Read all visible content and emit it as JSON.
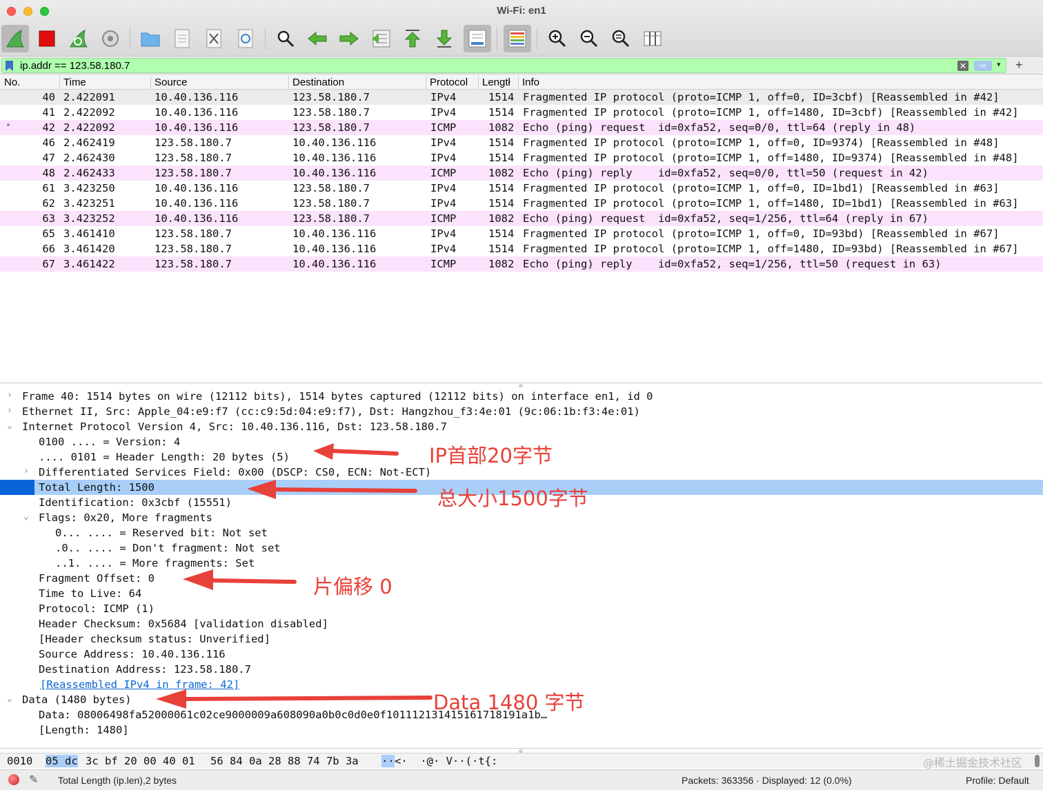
{
  "window": {
    "title": "Wi-Fi: en1"
  },
  "toolbar": {
    "buttons": [
      "start-capture-icon",
      "stop-capture-icon",
      "restart-capture-icon",
      "capture-options-icon",
      "open-file-icon",
      "save-file-icon",
      "close-file-icon",
      "reload-file-icon",
      "find-packet-icon",
      "go-back-icon",
      "go-forward-icon",
      "go-to-packet-icon",
      "go-first-icon",
      "go-last-icon",
      "autoscroll-icon",
      "colorize-icon",
      "zoom-in-icon",
      "zoom-out-icon",
      "zoom-normal-icon",
      "resize-columns-icon"
    ]
  },
  "filter": {
    "value": "ip.addr == 123.58.180.7",
    "clear": "✕",
    "apply": "⇨",
    "dropdown": "▾",
    "add": "+"
  },
  "packet_list": {
    "columns": [
      "No.",
      "Time",
      "Source",
      "Destination",
      "Protocol",
      "Lengtł",
      "Info"
    ],
    "rows": [
      {
        "no": "40",
        "time": "2.422091",
        "src": "10.40.136.116",
        "dst": "123.58.180.7",
        "proto": "IPv4",
        "len": "1514",
        "info": "Fragmented IP protocol (proto=ICMP 1, off=0, ID=3cbf) [Reassembled in #42]",
        "color": "#ebebeb",
        "mark": ""
      },
      {
        "no": "41",
        "time": "2.422092",
        "src": "10.40.136.116",
        "dst": "123.58.180.7",
        "proto": "IPv4",
        "len": "1514",
        "info": "Fragmented IP protocol (proto=ICMP 1, off=1480, ID=3cbf) [Reassembled in #42]",
        "color": "#ffffff",
        "mark": ""
      },
      {
        "no": "42",
        "time": "2.422092",
        "src": "10.40.136.116",
        "dst": "123.58.180.7",
        "proto": "ICMP",
        "len": "1082",
        "info": "Echo (ping) request  id=0xfa52, seq=0/0, ttl=64 (reply in 48)",
        "color": "#fbe3fd",
        "mark": "•"
      },
      {
        "no": "46",
        "time": "2.462419",
        "src": "123.58.180.7",
        "dst": "10.40.136.116",
        "proto": "IPv4",
        "len": "1514",
        "info": "Fragmented IP protocol (proto=ICMP 1, off=0, ID=9374) [Reassembled in #48]",
        "color": "#ffffff",
        "mark": ""
      },
      {
        "no": "47",
        "time": "2.462430",
        "src": "123.58.180.7",
        "dst": "10.40.136.116",
        "proto": "IPv4",
        "len": "1514",
        "info": "Fragmented IP protocol (proto=ICMP 1, off=1480, ID=9374) [Reassembled in #48]",
        "color": "#ffffff",
        "mark": ""
      },
      {
        "no": "48",
        "time": "2.462433",
        "src": "123.58.180.7",
        "dst": "10.40.136.116",
        "proto": "ICMP",
        "len": "1082",
        "info": "Echo (ping) reply    id=0xfa52, seq=0/0, ttl=50 (request in 42)",
        "color": "#fbe3fd",
        "mark": ""
      },
      {
        "no": "61",
        "time": "3.423250",
        "src": "10.40.136.116",
        "dst": "123.58.180.7",
        "proto": "IPv4",
        "len": "1514",
        "info": "Fragmented IP protocol (proto=ICMP 1, off=0, ID=1bd1) [Reassembled in #63]",
        "color": "#ffffff",
        "mark": ""
      },
      {
        "no": "62",
        "time": "3.423251",
        "src": "10.40.136.116",
        "dst": "123.58.180.7",
        "proto": "IPv4",
        "len": "1514",
        "info": "Fragmented IP protocol (proto=ICMP 1, off=1480, ID=1bd1) [Reassembled in #63]",
        "color": "#ffffff",
        "mark": ""
      },
      {
        "no": "63",
        "time": "3.423252",
        "src": "10.40.136.116",
        "dst": "123.58.180.7",
        "proto": "ICMP",
        "len": "1082",
        "info": "Echo (ping) request  id=0xfa52, seq=1/256, ttl=64 (reply in 67)",
        "color": "#fbe3fd",
        "mark": ""
      },
      {
        "no": "65",
        "time": "3.461410",
        "src": "123.58.180.7",
        "dst": "10.40.136.116",
        "proto": "IPv4",
        "len": "1514",
        "info": "Fragmented IP protocol (proto=ICMP 1, off=0, ID=93bd) [Reassembled in #67]",
        "color": "#ffffff",
        "mark": ""
      },
      {
        "no": "66",
        "time": "3.461420",
        "src": "123.58.180.7",
        "dst": "10.40.136.116",
        "proto": "IPv4",
        "len": "1514",
        "info": "Fragmented IP protocol (proto=ICMP 1, off=1480, ID=93bd) [Reassembled in #67]",
        "color": "#ffffff",
        "mark": ""
      },
      {
        "no": "67",
        "time": "3.461422",
        "src": "123.58.180.7",
        "dst": "10.40.136.116",
        "proto": "ICMP",
        "len": "1082",
        "info": "Echo (ping) reply    id=0xfa52, seq=1/256, ttl=50 (request in 63)",
        "color": "#fbe3fd",
        "mark": ""
      }
    ]
  },
  "details": [
    {
      "chev": "›",
      "text": "Frame 40: 1514 bytes on wire (12112 bits), 1514 bytes captured (12112 bits) on interface en1, id 0",
      "level": 0
    },
    {
      "chev": "›",
      "text": "Ethernet II, Src: Apple_04:e9:f7 (cc:c9:5d:04:e9:f7), Dst: Hangzhou_f3:4e:01 (9c:06:1b:f3:4e:01)",
      "level": 0
    },
    {
      "chev": "⌄",
      "text": "Internet Protocol Version 4, Src: 10.40.136.116, Dst: 123.58.180.7",
      "level": 0
    },
    {
      "chev": "",
      "text": "0100 .... = Version: 4",
      "level": 1
    },
    {
      "chev": "",
      "text": ".... 0101 = Header Length: 20 bytes (5)",
      "level": 1
    },
    {
      "chev": "›",
      "text": "Differentiated Services Field: 0x00 (DSCP: CS0, ECN: Not-ECT)",
      "level": 1
    },
    {
      "chev": "",
      "text": "Total Length: 1500",
      "level": 1,
      "selected": true
    },
    {
      "chev": "",
      "text": "Identification: 0x3cbf (15551)",
      "level": 1
    },
    {
      "chev": "⌄",
      "text": "Flags: 0x20, More fragments",
      "level": 1
    },
    {
      "chev": "",
      "text": "0... .... = Reserved bit: Not set",
      "level": 2
    },
    {
      "chev": "",
      "text": ".0.. .... = Don't fragment: Not set",
      "level": 2
    },
    {
      "chev": "",
      "text": "..1. .... = More fragments: Set",
      "level": 2
    },
    {
      "chev": "",
      "text": "Fragment Offset: 0",
      "level": 1
    },
    {
      "chev": "",
      "text": "Time to Live: 64",
      "level": 1
    },
    {
      "chev": "",
      "text": "Protocol: ICMP (1)",
      "level": 1
    },
    {
      "chev": "",
      "text": "Header Checksum: 0x5684 [validation disabled]",
      "level": 1
    },
    {
      "chev": "",
      "text": "[Header checksum status: Unverified]",
      "level": 1
    },
    {
      "chev": "",
      "text": "Source Address: 10.40.136.116",
      "level": 1
    },
    {
      "chev": "",
      "text": "Destination Address: 123.58.180.7",
      "level": 1
    },
    {
      "chev": "",
      "text": "[Reassembled IPv4 in frame: 42]",
      "level": 1,
      "link": true
    },
    {
      "chev": "⌄",
      "text": "Data (1480 bytes)",
      "level": 0
    },
    {
      "chev": "",
      "text": "Data: 08006498fa52000061c02ce9000009a608090a0b0c0d0e0f101112131415161718191a1b…",
      "level": 1
    },
    {
      "chev": "",
      "text": "[Length: 1480]",
      "level": 1
    }
  ],
  "annotations": {
    "header": "IP首部20字节",
    "total": "总大小1500字节",
    "offset": "片偏移 0",
    "data": "Data 1480 字节",
    "color": "#e8413a"
  },
  "hex": {
    "offset": "0010",
    "selected": "05 dc",
    "rest1": "3c bf 20 00 40 01",
    "rest2": "56 84 0a 28 88 74 7b 3a",
    "ascii_sel": "··",
    "ascii_rest": "<·  ·@· V··(·t{:",
    "watermark": "@稀土掘金技术社区"
  },
  "status": {
    "field": "Total Length (ip.len),2 bytes",
    "packets": "Packets: 363356 · Displayed: 12 (0.0%)",
    "profile": "Profile: Default"
  }
}
